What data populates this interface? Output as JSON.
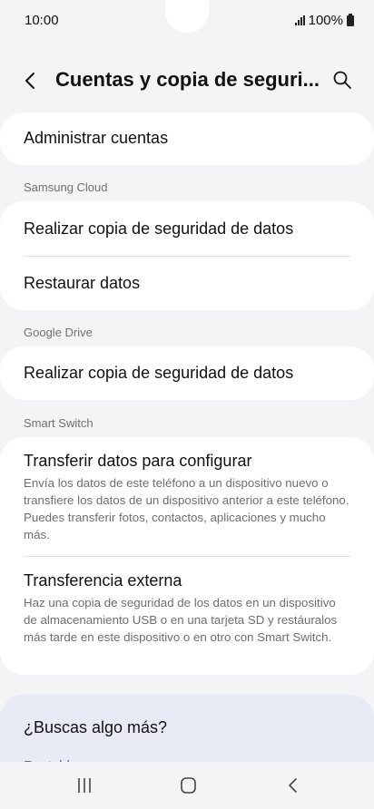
{
  "status_bar": {
    "time": "10:00",
    "battery": "100%"
  },
  "header": {
    "title": "Cuentas y copia de seguri...",
    "back_icon": "chevron-left-icon",
    "search_icon": "search-icon"
  },
  "account_card": {
    "items": [
      {
        "title": "Administrar cuentas"
      }
    ]
  },
  "sections": [
    {
      "label": "Samsung Cloud",
      "items": [
        {
          "title": "Realizar copia de seguridad de datos"
        },
        {
          "title": "Restaurar datos"
        }
      ]
    },
    {
      "label": "Google Drive",
      "items": [
        {
          "title": "Realizar copia de seguridad de datos"
        }
      ]
    },
    {
      "label": "Smart Switch",
      "items": [
        {
          "title": "Transferir datos para configurar",
          "description": "Envía los datos de este teléfono a un dispositivo nuevo o transfiere los datos de un dispositivo anterior a este teléfono. Puedes transferir fotos, contactos, aplicaciones y mucho más."
        },
        {
          "title": "Transferencia externa",
          "description": "Haz una copia de seguridad de los datos en un dispositivo de almacenamiento USB o en una tarjeta SD y restáuralos más tarde en este dispositivo o en otro con Smart Switch."
        }
      ]
    }
  ],
  "suggestion": {
    "title": "¿Buscas algo más?",
    "link": "Restablecer"
  },
  "nav_bar": {
    "recents_icon": "recents-icon",
    "home_icon": "home-icon",
    "back_icon": "back-icon"
  },
  "colors": {
    "background": "#f4f4f6",
    "card": "#ffffff",
    "suggest_card": "#e8ebf6",
    "link": "#3f6bd6"
  }
}
